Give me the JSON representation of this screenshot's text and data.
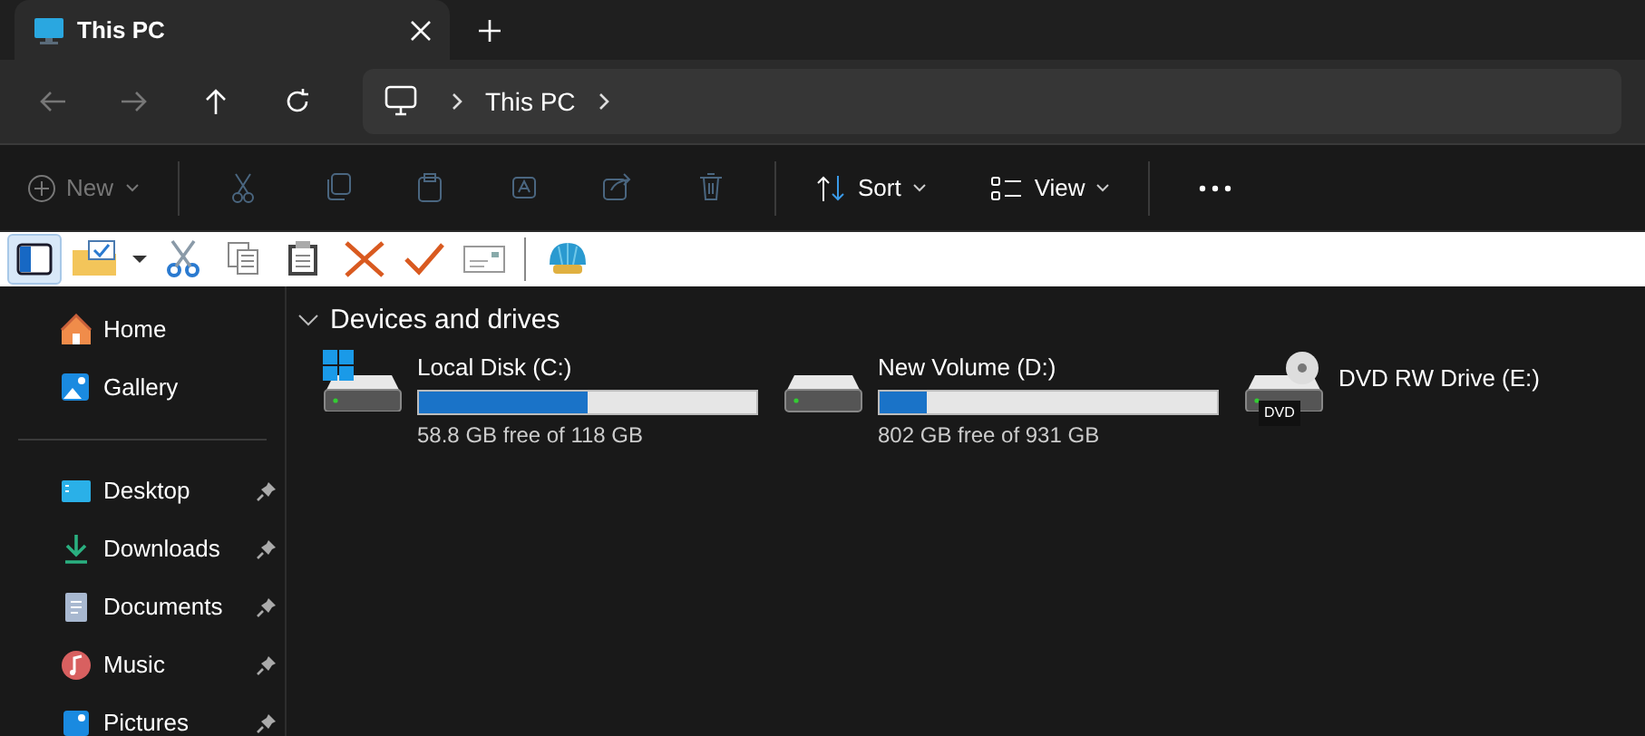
{
  "tabs": [
    {
      "title": "This PC",
      "selected": true
    }
  ],
  "address": {
    "crumbs": [
      "This PC"
    ]
  },
  "command_bar": {
    "new": {
      "label": "New",
      "disabled": true
    },
    "sort": {
      "label": "Sort"
    },
    "view": {
      "label": "View"
    }
  },
  "legacy_toolbar": {
    "pane_toggle": {
      "selected": true
    }
  },
  "sidebar": {
    "items": [
      {
        "label": "Home",
        "kind": "home",
        "pinned": false
      },
      {
        "label": "Gallery",
        "kind": "gallery",
        "pinned": false
      }
    ],
    "quick_access": [
      {
        "label": "Desktop",
        "kind": "desktop",
        "pinned": true
      },
      {
        "label": "Downloads",
        "kind": "downloads",
        "pinned": true
      },
      {
        "label": "Documents",
        "kind": "documents",
        "pinned": true
      },
      {
        "label": "Music",
        "kind": "music",
        "pinned": true
      },
      {
        "label": "Pictures",
        "kind": "pictures",
        "pinned": true
      }
    ]
  },
  "section": {
    "title": "Devices and drives",
    "expanded": true,
    "drives": [
      {
        "name": "Local Disk (C:)",
        "kind": "system",
        "level": 0.5,
        "reading": "58.8 GB free of 118 GB"
      },
      {
        "name": "New Volume (D:)",
        "kind": "disk",
        "level": 0.14,
        "reading": "802 GB free of 931 GB"
      },
      {
        "name": "DVD RW Drive (E:)",
        "kind": "dvd",
        "badge": "DVD"
      }
    ]
  }
}
